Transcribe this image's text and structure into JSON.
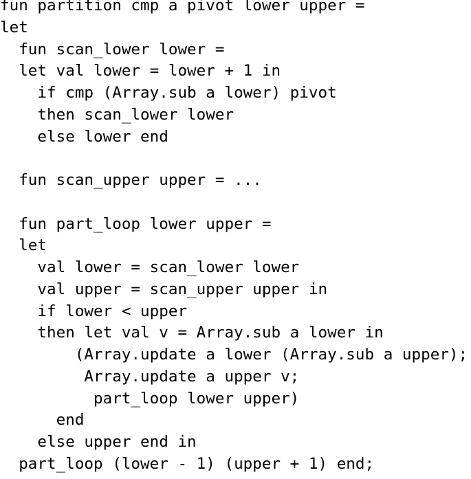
{
  "document": {
    "kind": "code-listing",
    "language": "Standard ML",
    "background_color": "#ffffff",
    "text_color": "#000000",
    "lines": [
      "fun partition cmp a pivot lower upper =",
      "let",
      "  fun scan_lower lower =",
      "  let val lower = lower + 1 in",
      "    if cmp (Array.sub a lower) pivot",
      "    then scan_lower lower",
      "    else lower end",
      "",
      "  fun scan_upper upper = ...",
      "",
      "  fun part_loop lower upper =",
      "  let",
      "    val lower = scan_lower lower",
      "    val upper = scan_upper upper in",
      "    if lower < upper",
      "    then let val v = Array.sub a lower in",
      "        (Array.update a lower (Array.sub a upper);",
      "         Array.update a upper v;",
      "          part_loop lower upper)",
      "      end",
      "    else upper end in",
      "  part_loop (lower - 1) (upper + 1) end;"
    ]
  }
}
